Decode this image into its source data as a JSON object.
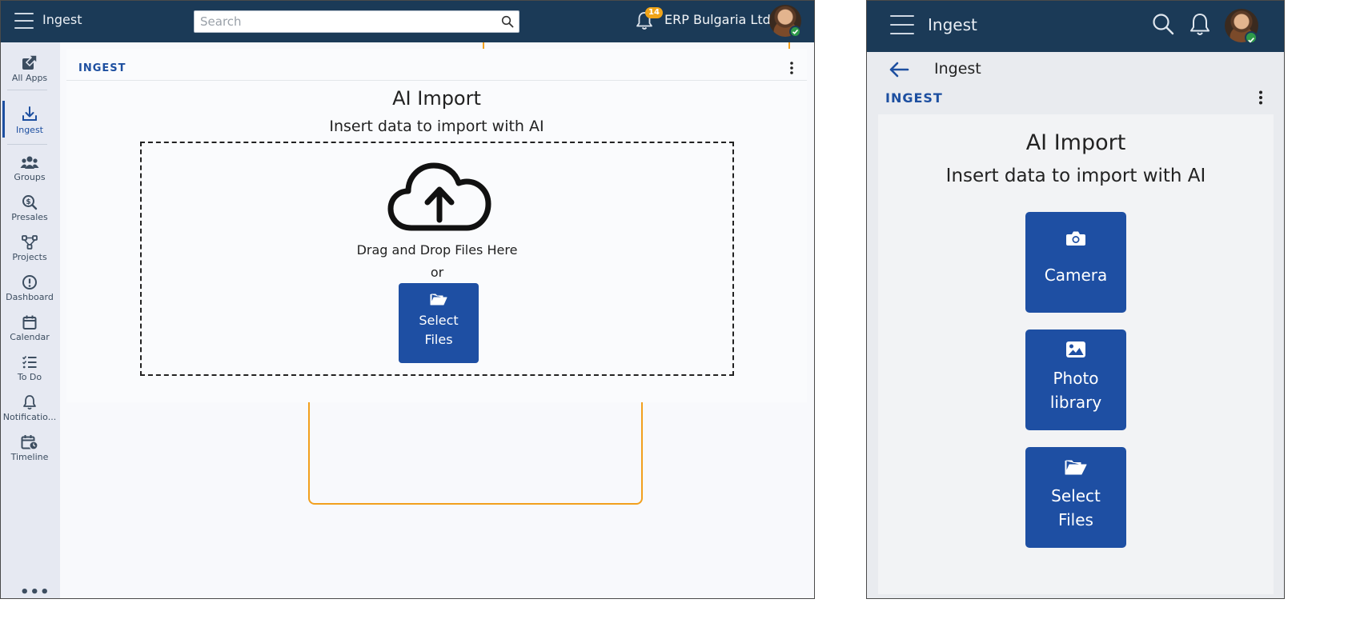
{
  "desktop": {
    "header": {
      "app_name": "Ingest",
      "search_placeholder": "Search",
      "notification_count": "14",
      "org_name": "ERP Bulgaria Ltd"
    },
    "sidebar": {
      "items": [
        {
          "label": "All Apps",
          "icon": "external-link-icon"
        },
        {
          "label": "Ingest",
          "icon": "download-icon",
          "active": true
        },
        {
          "label": "Groups",
          "icon": "users-icon"
        },
        {
          "label": "Presales",
          "icon": "dollar-search-icon"
        },
        {
          "label": "Projects",
          "icon": "project-tree-icon"
        },
        {
          "label": "Dashboard",
          "icon": "info-circle-icon"
        },
        {
          "label": "Calendar",
          "icon": "calendar-icon"
        },
        {
          "label": "To Do",
          "icon": "checklist-icon"
        },
        {
          "label": "Notificatio...",
          "icon": "bell-icon"
        },
        {
          "label": "Timeline",
          "icon": "calendar-clock-icon"
        }
      ],
      "more": "•••"
    },
    "panel": {
      "title": "INGEST",
      "heading": "AI Import",
      "subheading": "Insert data to import with AI",
      "drop_text": "Drag and Drop Files Here",
      "or_text": "or",
      "select_line1": "Select",
      "select_line2": "Files"
    }
  },
  "mobile": {
    "header": {
      "app_name": "Ingest"
    },
    "page_title": "Ingest",
    "section_title": "INGEST",
    "heading": "AI Import",
    "subheading": "Insert data to import with AI",
    "buttons": [
      {
        "line1": "Camera",
        "line2": "",
        "icon": "camera-icon"
      },
      {
        "line1": "Photo",
        "line2": "library",
        "icon": "image-icon"
      },
      {
        "line1": "Select",
        "line2": "Files",
        "icon": "folder-open-icon"
      }
    ]
  },
  "colors": {
    "header_bg": "#1b3a57",
    "accent_blue": "#1e4fa3",
    "sidebar_bg": "#e6e9f2",
    "badge": "#f0a418",
    "status_online": "#2e9a4a",
    "highlight_orange": "#f2a01e"
  }
}
